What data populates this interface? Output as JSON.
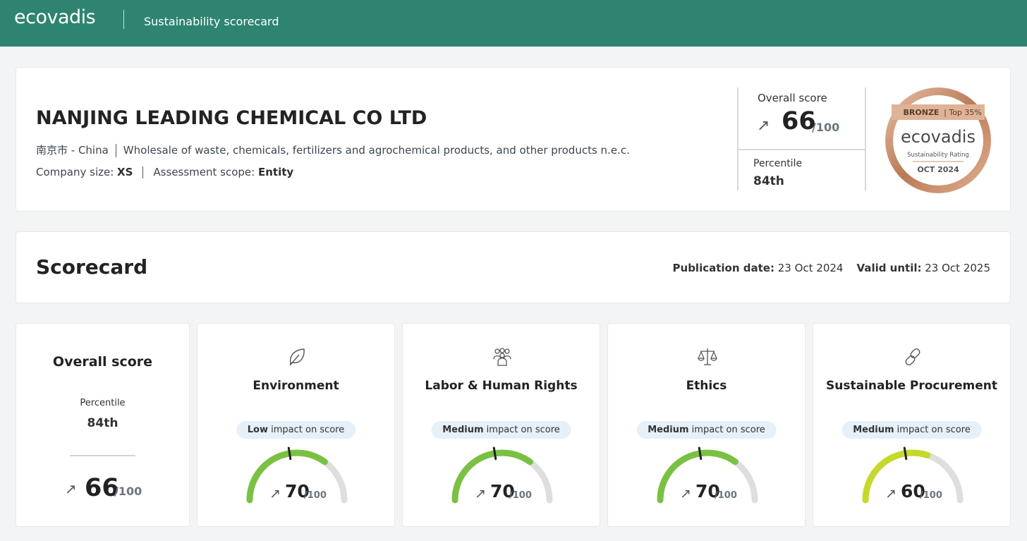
{
  "header": {
    "logo_text": "ecovadis",
    "app_title": "Sustainability scorecard",
    "bg_color": "#2e8471"
  },
  "company": {
    "name": "NANJING LEADING CHEMICAL CO LTD",
    "location": "南京市 - China",
    "industry": "Wholesale of waste, chemicals, fertilizers and agrochemical products, and other products n.e.c.",
    "size_label": "Company size: ",
    "size_value": "XS",
    "scope_label": "Assessment scope: ",
    "scope_value": "Entity"
  },
  "summary": {
    "overall_label": "Overall score",
    "trend_icon": "arrow-up-right-icon",
    "overall_value": "66",
    "overall_den": "/100",
    "percentile_label": "Percentile",
    "percentile_value": "84th"
  },
  "medal": {
    "tier": "BRONZE",
    "rank": "| Top 35%",
    "brand": "ecovadis",
    "subtitle": "Sustainability Rating",
    "date": "OCT 2024"
  },
  "scorecard": {
    "title": "Scorecard",
    "pub_label": "Publication date:",
    "pub_value": " 23 Oct 2024",
    "valid_label": "Valid until:",
    "valid_value": " 23 Oct 2025"
  },
  "overall_card": {
    "title": "Overall score",
    "percentile_label": "Percentile",
    "percentile_value": "84th",
    "value": "66",
    "den": "/100"
  },
  "themes": [
    {
      "title": "Environment",
      "icon": "leaf-icon",
      "impact_level": "Low",
      "impact_suffix": " impact on score",
      "score": "70",
      "den": "/100",
      "score_fraction": 0.7,
      "color": "#7ac143"
    },
    {
      "title": "Labor & Human Rights",
      "icon": "people-icon",
      "impact_level": "Medium",
      "impact_suffix": " impact on score",
      "score": "70",
      "den": "/100",
      "score_fraction": 0.7,
      "color": "#7ac143"
    },
    {
      "title": "Ethics",
      "icon": "scales-icon",
      "impact_level": "Medium",
      "impact_suffix": " impact on score",
      "score": "70",
      "den": "/100",
      "score_fraction": 0.7,
      "color": "#7ac143"
    },
    {
      "title": "Sustainable Procurement",
      "icon": "chain-link-icon",
      "impact_level": "Medium",
      "impact_suffix": " impact on score",
      "score": "60",
      "den": "/100",
      "score_fraction": 0.6,
      "color": "#c5d82b"
    }
  ]
}
